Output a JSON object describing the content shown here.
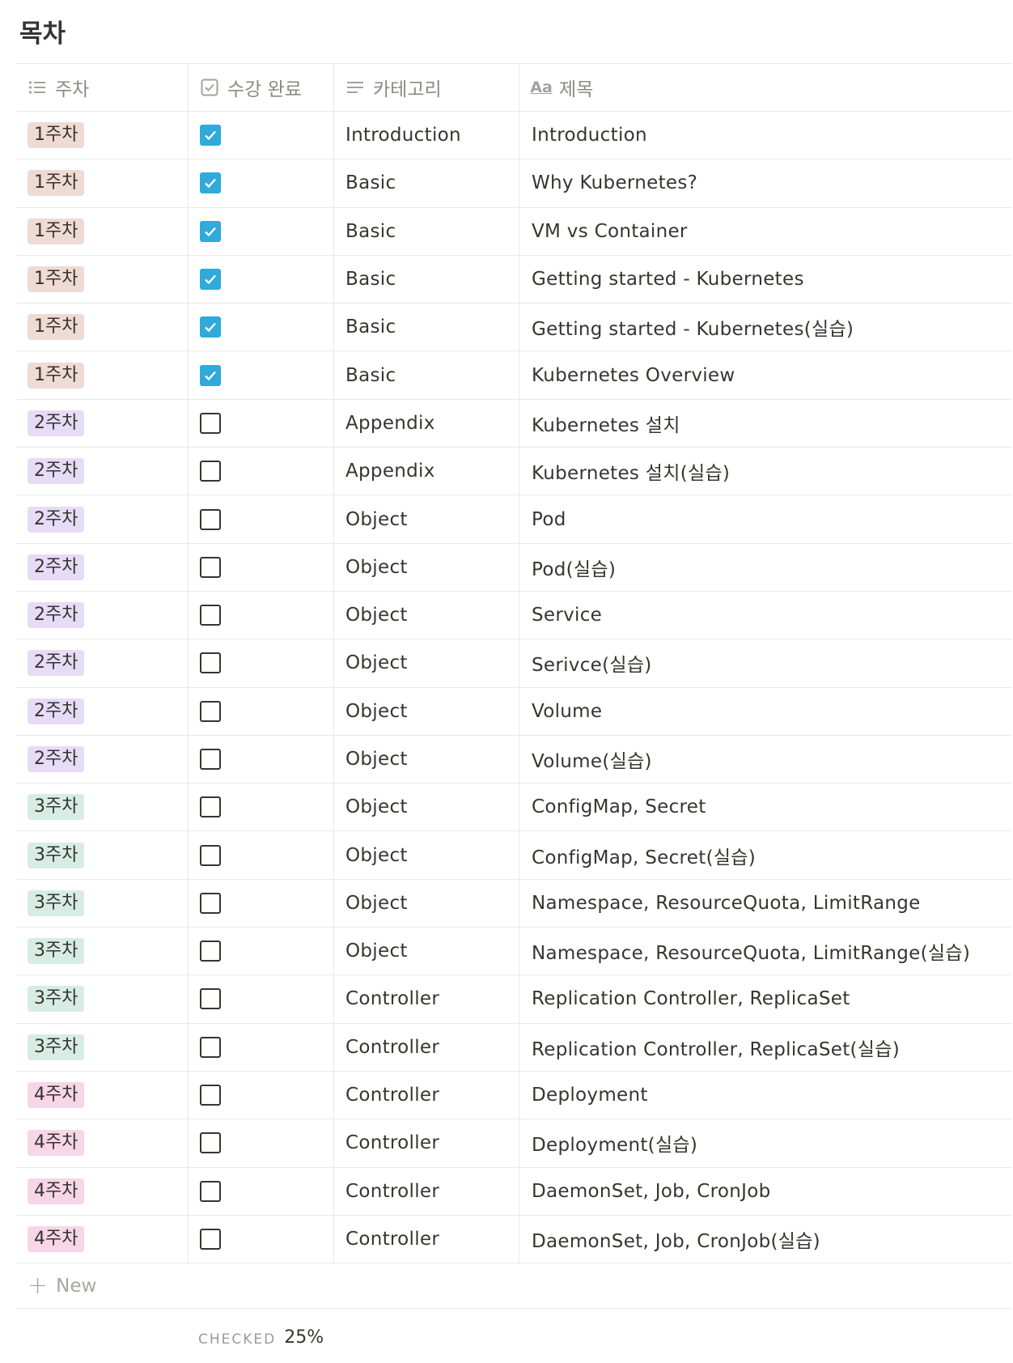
{
  "page": {
    "title": "목차"
  },
  "table": {
    "headers": {
      "week": "주차",
      "done": "수강 완료",
      "category": "카테고리",
      "title": "제목",
      "title_icon": "Aa"
    },
    "rows": [
      {
        "week": "1주차",
        "week_color": "#eedbd3",
        "done": true,
        "category": "Introduction",
        "title": "Introduction"
      },
      {
        "week": "1주차",
        "week_color": "#eedbd3",
        "done": true,
        "category": "Basic",
        "title": "Why Kubernetes?"
      },
      {
        "week": "1주차",
        "week_color": "#eedbd3",
        "done": true,
        "category": "Basic",
        "title": "VM vs Container"
      },
      {
        "week": "1주차",
        "week_color": "#eedbd3",
        "done": true,
        "category": "Basic",
        "title": "Getting started - Kubernetes"
      },
      {
        "week": "1주차",
        "week_color": "#eedbd3",
        "done": true,
        "category": "Basic",
        "title": "Getting started - Kubernetes(실습)"
      },
      {
        "week": "1주차",
        "week_color": "#eedbd3",
        "done": true,
        "category": "Basic",
        "title": "Kubernetes Overview"
      },
      {
        "week": "2주차",
        "week_color": "#e6dcf5",
        "done": false,
        "category": "Appendix",
        "title": "Kubernetes 설치"
      },
      {
        "week": "2주차",
        "week_color": "#e6dcf5",
        "done": false,
        "category": "Appendix",
        "title": "Kubernetes 설치(실습)"
      },
      {
        "week": "2주차",
        "week_color": "#e6dcf5",
        "done": false,
        "category": "Object",
        "title": "Pod"
      },
      {
        "week": "2주차",
        "week_color": "#e6dcf5",
        "done": false,
        "category": "Object",
        "title": "Pod(실습)"
      },
      {
        "week": "2주차",
        "week_color": "#e6dcf5",
        "done": false,
        "category": "Object",
        "title": "Service"
      },
      {
        "week": "2주차",
        "week_color": "#e6dcf5",
        "done": false,
        "category": "Object",
        "title": "Serivce(실습)"
      },
      {
        "week": "2주차",
        "week_color": "#e6dcf5",
        "done": false,
        "category": "Object",
        "title": "Volume"
      },
      {
        "week": "2주차",
        "week_color": "#e6dcf5",
        "done": false,
        "category": "Object",
        "title": "Volume(실습)"
      },
      {
        "week": "3주차",
        "week_color": "#d7ece5",
        "done": false,
        "category": "Object",
        "title": "ConfigMap, Secret"
      },
      {
        "week": "3주차",
        "week_color": "#d7ece5",
        "done": false,
        "category": "Object",
        "title": "ConfigMap, Secret(실습)"
      },
      {
        "week": "3주차",
        "week_color": "#d7ece5",
        "done": false,
        "category": "Object",
        "title": "Namespace, ResourceQuota, LimitRange"
      },
      {
        "week": "3주차",
        "week_color": "#d7ece5",
        "done": false,
        "category": "Object",
        "title": "Namespace, ResourceQuota, LimitRange(실습)"
      },
      {
        "week": "3주차",
        "week_color": "#d7ece5",
        "done": false,
        "category": "Controller",
        "title": "Replication Controller, ReplicaSet"
      },
      {
        "week": "3주차",
        "week_color": "#d7ece5",
        "done": false,
        "category": "Controller",
        "title": "Replication Controller, ReplicaSet(실습)"
      },
      {
        "week": "4주차",
        "week_color": "#f6d6e7",
        "done": false,
        "category": "Controller",
        "title": "Deployment"
      },
      {
        "week": "4주차",
        "week_color": "#f6d6e7",
        "done": false,
        "category": "Controller",
        "title": "Deployment(실습)"
      },
      {
        "week": "4주차",
        "week_color": "#f6d6e7",
        "done": false,
        "category": "Controller",
        "title": "DaemonSet, Job, CronJob"
      },
      {
        "week": "4주차",
        "week_color": "#f6d6e7",
        "done": false,
        "category": "Controller",
        "title": "DaemonSet, Job, CronJob(실습)"
      }
    ],
    "new_label": "New",
    "footer": {
      "calc_label": "CHECKED",
      "calc_value": "25%"
    }
  },
  "colors": {
    "checked": "#2eaadc",
    "text": "#37352f",
    "muted": "#8b8a86",
    "border": "#e9e9e7"
  },
  "icons": {
    "week": "list-icon",
    "done": "checkbox-icon",
    "category": "text-lines-icon",
    "title": "title-property-icon",
    "new": "plus-icon"
  }
}
